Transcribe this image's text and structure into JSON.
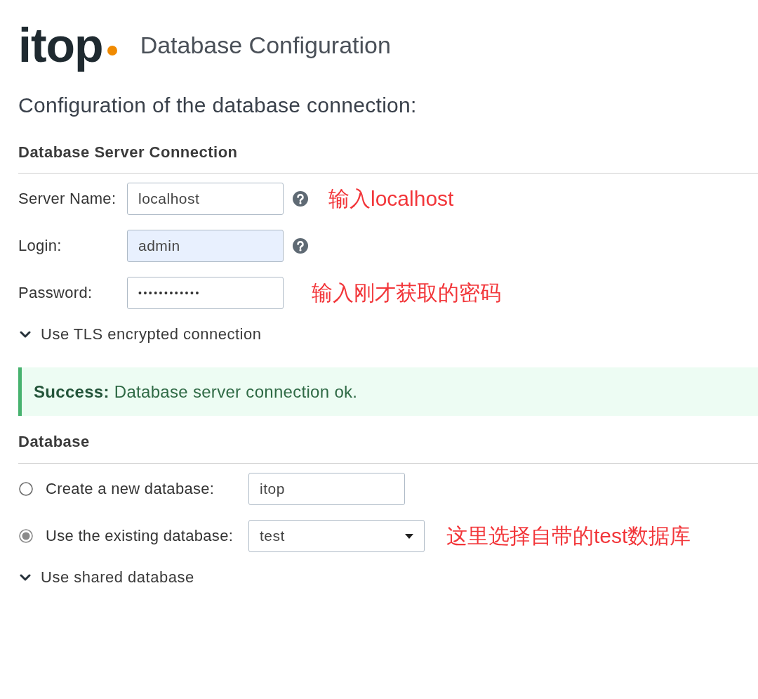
{
  "header": {
    "logo": "itop",
    "title": "Database Configuration"
  },
  "intro": "Configuration of the database connection:",
  "server_section": {
    "heading": "Database Server Connection",
    "fields": [
      {
        "label": "Server Name:",
        "kind": "text",
        "value": "localhost",
        "autofilled": false,
        "help": true,
        "annotation": "输入localhost"
      },
      {
        "label": "Login:",
        "kind": "text",
        "value": "admin",
        "autofilled": true,
        "help": true
      },
      {
        "label": "Password:",
        "kind": "password",
        "value": "••••••••••••",
        "autofilled": false,
        "help": false,
        "annotation": "输入刚才获取的密码"
      }
    ],
    "toggle": "Use TLS encrypted connection"
  },
  "alert": {
    "kind": "success",
    "text": "**Success:** Database server connection ok."
  },
  "database_section": {
    "heading": "Database",
    "options": [
      {
        "label": "Create a new database:",
        "selected": false,
        "kind": "input",
        "value": "itop"
      },
      {
        "label": "Use the existing database:",
        "selected": true,
        "kind": "select",
        "value": "test",
        "annotation": "这里选择自带的test数据库"
      }
    ],
    "toggle": "Use shared database"
  }
}
